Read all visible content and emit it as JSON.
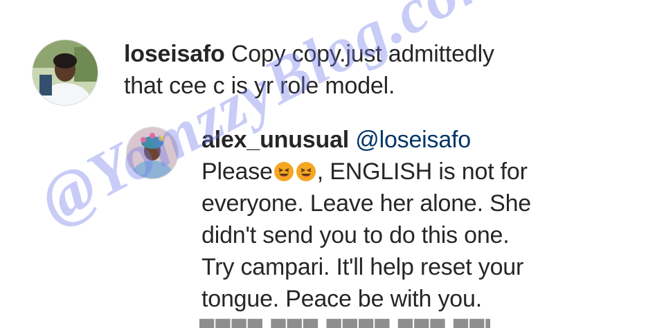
{
  "comments": [
    {
      "username": "loseisafo",
      "text_line1": "Copy copy.just admittedly",
      "text_line2": "that cee c is yr role model."
    }
  ],
  "reply": {
    "username": "alex_unusual",
    "mention": "@loseisafo",
    "text_prefix": "Please",
    "emoji_names": [
      "laughing-emoji",
      "laughing-emoji"
    ],
    "text_after_emoji": ", ENGLISH is not for",
    "lines": [
      "everyone. Leave her alone. She",
      "didn't send you to do this one.",
      "Try campari. It'll help reset your",
      "tongue. Peace be with you."
    ]
  },
  "watermark": "@YomzzyBlog.com",
  "colors": {
    "text": "#262626",
    "mention": "#003569",
    "watermark": "#6e78eb",
    "emoji": "#f5a623"
  }
}
